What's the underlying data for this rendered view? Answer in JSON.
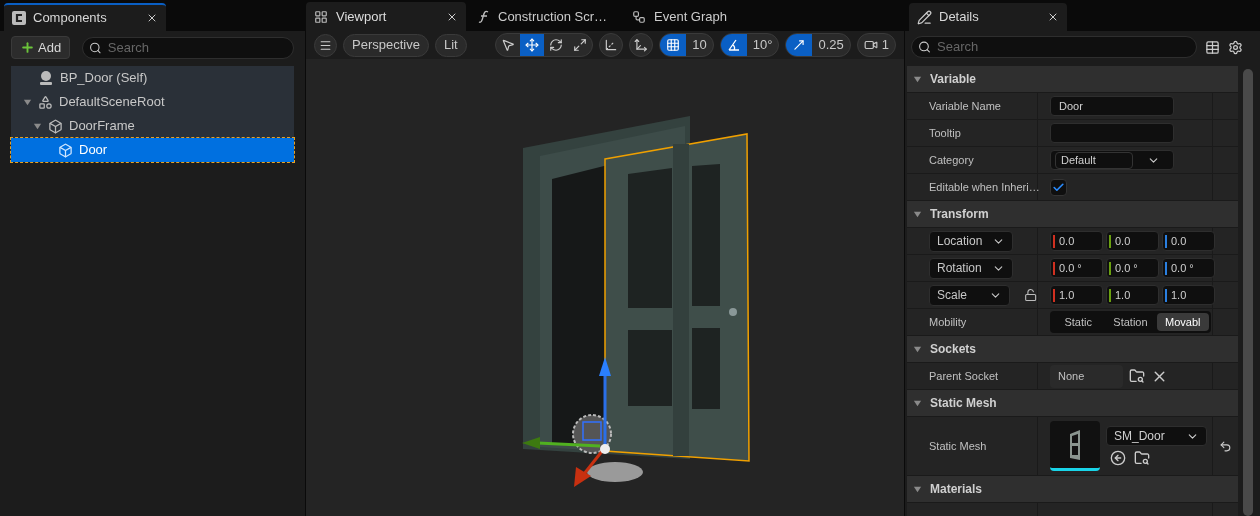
{
  "components_panel": {
    "tab": "Components",
    "add_button": "Add",
    "search": {
      "placeholder": "Search"
    },
    "tree": [
      {
        "label": "BP_Door (Self)",
        "kind": "actor",
        "selected": false
      },
      {
        "label": "DefaultSceneRoot",
        "kind": "scene",
        "selected": false,
        "expanded": true,
        "children": [
          {
            "label": "DoorFrame",
            "kind": "mesh",
            "selected": false,
            "expanded": true,
            "children": [
              {
                "label": "Door",
                "kind": "mesh",
                "selected": true
              }
            ]
          }
        ]
      }
    ]
  },
  "editor_tabs": [
    {
      "label": "Viewport",
      "kind": "viewport",
      "selected": true,
      "closable": true
    },
    {
      "label": "Construction Scr…",
      "kind": "function",
      "selected": false,
      "closable": false
    },
    {
      "label": "Event Graph",
      "kind": "graph",
      "selected": false,
      "closable": false
    }
  ],
  "viewport_toolbar": {
    "view_mode": "Perspective",
    "lighting": "Lit",
    "transform_tools": [
      {
        "kind": "select",
        "selected": false
      },
      {
        "kind": "move",
        "selected": true
      },
      {
        "kind": "rotate",
        "selected": false
      },
      {
        "kind": "scale",
        "selected": false
      }
    ],
    "grid_snap": {
      "on": true,
      "value": "10"
    },
    "rotation_snap": {
      "on": true,
      "value": "10°"
    },
    "scale_snap": {
      "on": true,
      "value": "0.25"
    },
    "camera_speed": "1"
  },
  "details_panel": {
    "tab": "Details",
    "search": {
      "placeholder": "Search"
    },
    "sections": [
      {
        "title": "Variable",
        "expanded": true,
        "rows": [
          {
            "kind": "text",
            "label": "Variable Name",
            "value": "Door"
          },
          {
            "kind": "text",
            "label": "Tooltip"
          },
          {
            "kind": "combo",
            "label": "Category",
            "value": "Default"
          },
          {
            "kind": "checkbox",
            "label": "Editable when Inheri…",
            "checked": true
          }
        ]
      },
      {
        "title": "Transform",
        "expanded": true,
        "rows": [
          {
            "kind": "vector",
            "mode": "Location",
            "values": [
              "0.0",
              "0.0",
              "0.0"
            ]
          },
          {
            "kind": "vector",
            "mode": "Rotation",
            "values": [
              "0.0 °",
              "0.0 °",
              "0.0 °"
            ]
          },
          {
            "kind": "vector",
            "mode": "Scale",
            "locked": false,
            "values": [
              "1.0",
              "1.0",
              "1.0"
            ]
          },
          {
            "kind": "segmented",
            "label": "Mobility",
            "options": [
              {
                "label": "Static",
                "selected": false
              },
              {
                "label": "Station",
                "selected": false
              },
              {
                "label": "Movabl",
                "selected": true
              }
            ]
          }
        ]
      },
      {
        "title": "Sockets",
        "expanded": true,
        "rows": [
          {
            "kind": "socket",
            "label": "Parent Socket",
            "value": "None"
          }
        ]
      },
      {
        "title": "Static Mesh",
        "expanded": true,
        "rows": [
          {
            "kind": "asset",
            "label": "Static Mesh",
            "value": "SM_Door"
          }
        ]
      },
      {
        "title": "Materials",
        "expanded": true
      }
    ]
  }
}
